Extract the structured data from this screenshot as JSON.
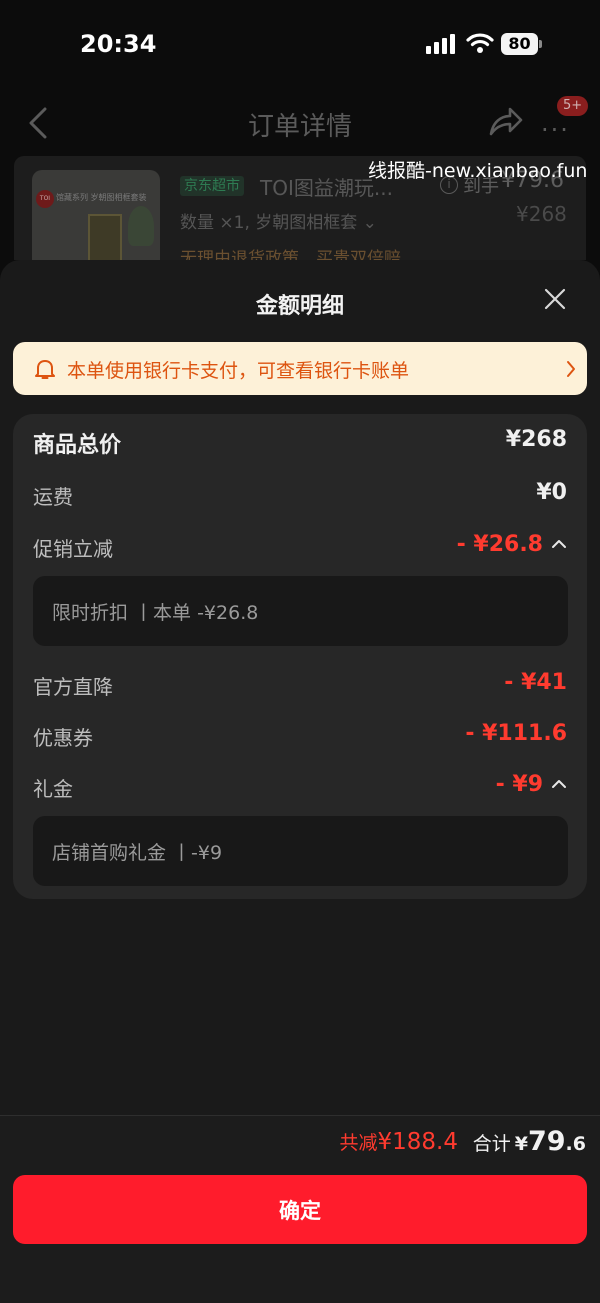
{
  "status_bar": {
    "time": "20:34",
    "battery": "80"
  },
  "nav": {
    "title": "订单详情",
    "badge": "5+"
  },
  "product": {
    "store_tag": "京东超市",
    "title": "TOI图益潮玩...",
    "qty_spec": "数量 ×1, 岁朝图相框套",
    "policy": "无理由退货政策，买贵双倍赔",
    "net_label": "到手",
    "net_price": "¥79.6",
    "orig_price": "¥268",
    "thumb_logo": "TOI",
    "thumb_caption": "馆藏系列 岁朝图相框套装"
  },
  "watermark": "线报酷-new.xianbao.fun",
  "sheet": {
    "title": "金额明细",
    "banner": "本单使用银行卡支付，可查看银行卡账单",
    "rows": {
      "goods_total": {
        "label": "商品总价",
        "value": "¥268"
      },
      "shipping": {
        "label": "运费",
        "value": "¥0"
      },
      "promo": {
        "label": "促销立减",
        "value": "- ¥26.8",
        "detail": "限时折扣 丨本单 -¥26.8"
      },
      "official": {
        "label": "官方直降",
        "value": "- ¥41"
      },
      "coupon": {
        "label": "优惠券",
        "value": "- ¥111.6"
      },
      "gift": {
        "label": "礼金",
        "value": "- ¥9",
        "detail": "店铺首购礼金 丨-¥9"
      }
    },
    "footer": {
      "discount_label": "共减",
      "discount_value": "¥188.4",
      "total_label": "合计",
      "total_yen": "¥",
      "total_int": "79",
      "total_dec": ".6",
      "confirm": "确定"
    }
  },
  "colors": {
    "accent_red": "#ff1c2c",
    "negative": "#ff3b2f",
    "banner_bg": "#fdf1d8",
    "banner_text": "#dd5410"
  }
}
